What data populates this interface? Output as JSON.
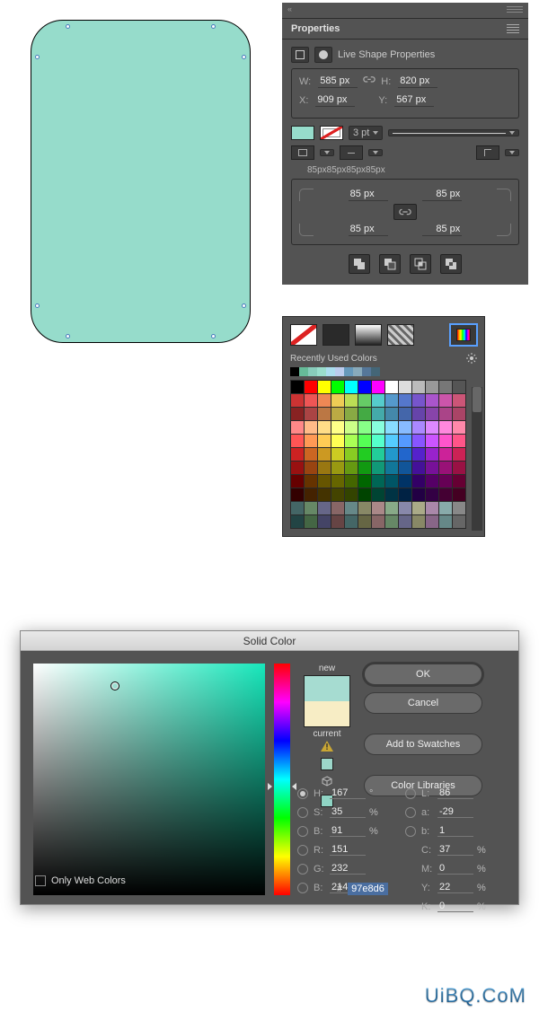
{
  "canvas": {
    "fill": "#96dccb"
  },
  "properties": {
    "panel_title": "Properties",
    "header": "Live Shape Properties",
    "w_label": "W:",
    "w": "585 px",
    "h_label": "H:",
    "h": "820 px",
    "x_label": "X:",
    "x": "909 px",
    "y_label": "Y:",
    "y": "567 px",
    "stroke_weight": "3 pt",
    "radius_summary": "85px85px85px85px",
    "r_tl": "85 px",
    "r_tr": "85 px",
    "r_bl": "85 px",
    "r_br": "85 px"
  },
  "flyout": {
    "recent_label": "Recently Used Colors"
  },
  "dialog": {
    "title": "Solid Color",
    "new_label": "new",
    "current_label": "current",
    "ok": "OK",
    "cancel": "Cancel",
    "add": "Add to Swatches",
    "libs": "Color Libraries",
    "H_label": "H:",
    "H": "167",
    "H_u": "°",
    "S_label": "S:",
    "S": "35",
    "S_u": "%",
    "Bv_label": "B:",
    "Bv": "91",
    "Bv_u": "%",
    "R_label": "R:",
    "R": "151",
    "G_label": "G:",
    "G": "232",
    "B_label": "B:",
    "B": "214",
    "L_label": "L:",
    "L": "86",
    "a_label": "a:",
    "a": "-29",
    "b_label": "b:",
    "b": "1",
    "C_label": "C:",
    "C": "37",
    "C_u": "%",
    "M_label": "M:",
    "M": "0",
    "M_u": "%",
    "Y_label": "Y:",
    "Y": "22",
    "Y_u": "%",
    "K_label": "K:",
    "K": "0",
    "K_u": "%",
    "hash": "#",
    "hex": "97e8d6",
    "owc": "Only Web Colors"
  },
  "watermark": "UiBQ.CoM",
  "swatch_rows": [
    [
      "#000",
      "#f00",
      "#ff0",
      "#0f0",
      "#0ff",
      "#00f",
      "#f0f",
      "#fff",
      "#ddd",
      "#bbb",
      "#999",
      "#777",
      "#555"
    ],
    [
      "#c33",
      "#e55",
      "#e85",
      "#ec5",
      "#bd5",
      "#6c6",
      "#5cc",
      "#59c",
      "#57c",
      "#75c",
      "#a5c",
      "#c5a",
      "#c57"
    ],
    [
      "#822",
      "#a44",
      "#b74",
      "#ba4",
      "#8a4",
      "#4a4",
      "#4aa",
      "#48a",
      "#46a",
      "#64a",
      "#84a",
      "#a48",
      "#a46"
    ],
    [
      "#f88",
      "#fb8",
      "#fd8",
      "#ff8",
      "#cf8",
      "#8f8",
      "#8fd",
      "#8df",
      "#8bf",
      "#a8f",
      "#d8f",
      "#f8d",
      "#f8a"
    ],
    [
      "#f55",
      "#f95",
      "#fc5",
      "#ff5",
      "#af5",
      "#5f5",
      "#5fc",
      "#5cf",
      "#59f",
      "#85f",
      "#c5f",
      "#f5c",
      "#f58"
    ],
    [
      "#c22",
      "#c62",
      "#c92",
      "#cc2",
      "#8c2",
      "#2c2",
      "#2c9",
      "#29c",
      "#26c",
      "#52c",
      "#92c",
      "#c29",
      "#c25"
    ],
    [
      "#911",
      "#941",
      "#971",
      "#991",
      "#691",
      "#191",
      "#197",
      "#179",
      "#159",
      "#419",
      "#719",
      "#917",
      "#914"
    ],
    [
      "#600",
      "#630",
      "#650",
      "#660",
      "#460",
      "#060",
      "#065",
      "#056",
      "#036",
      "#306",
      "#506",
      "#605",
      "#603"
    ],
    [
      "#300",
      "#420",
      "#430",
      "#440",
      "#340",
      "#040",
      "#043",
      "#034",
      "#024",
      "#204",
      "#304",
      "#403",
      "#402"
    ],
    [
      "#466",
      "#686",
      "#668",
      "#866",
      "#688",
      "#886",
      "#a88",
      "#8a8",
      "#88a",
      "#aa8",
      "#a8a",
      "#8aa",
      "#888"
    ],
    [
      "#244",
      "#464",
      "#446",
      "#644",
      "#466",
      "#664",
      "#866",
      "#686",
      "#668",
      "#886",
      "#868",
      "#688",
      "#666"
    ]
  ]
}
